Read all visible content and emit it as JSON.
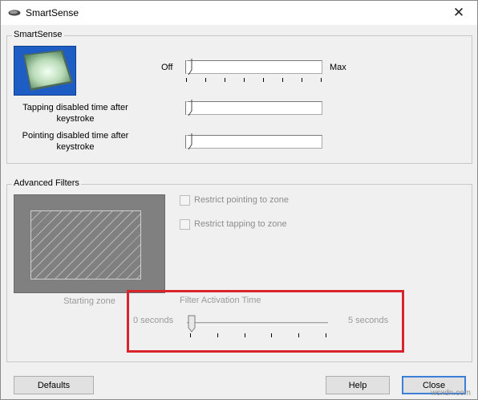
{
  "window": {
    "title": "SmartSense",
    "close_glyph": "✕"
  },
  "smartsense": {
    "legend": "SmartSense",
    "sensitivity": {
      "off_label": "Off",
      "max_label": "Max",
      "value": 0
    },
    "tapping": {
      "label": "Tapping disabled time after keystroke",
      "value": 0
    },
    "pointing": {
      "label": "Pointing disabled time after keystroke",
      "value": 0
    }
  },
  "advanced": {
    "legend": "Advanced Filters",
    "restrict_pointing": {
      "label": "Restrict pointing to zone",
      "checked": false,
      "enabled": false
    },
    "restrict_tapping": {
      "label": "Restrict tapping to zone",
      "checked": false,
      "enabled": false
    },
    "zone_caption": "Starting zone",
    "filter_activation": {
      "title": "Filter Activation Time",
      "min_label": "0 seconds",
      "max_label": "5 seconds",
      "value": 0
    }
  },
  "buttons": {
    "defaults": "Defaults",
    "help": "Help",
    "close": "Close"
  },
  "watermark": "wsxdn.com",
  "colors": {
    "highlight": "#d9232d",
    "focus_border": "#3c7fd6",
    "touchpad": "#1e5ec4"
  }
}
